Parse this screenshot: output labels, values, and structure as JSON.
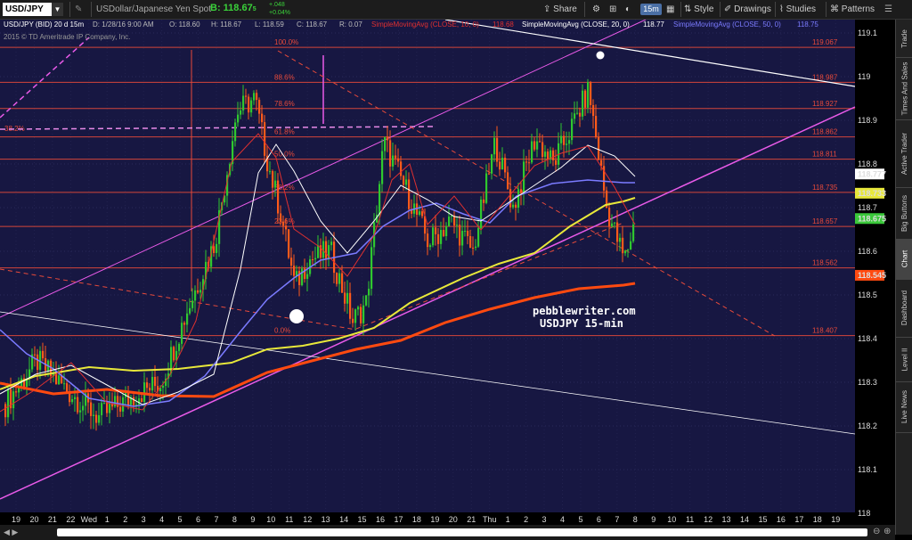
{
  "toolbar": {
    "symbol": "USD/JPY",
    "description": "USDollar/Japanese Yen Spot",
    "bid_label": "B:",
    "bid_value": "118.67",
    "bid_sub": "5",
    "change_top": "+.048",
    "change_bottom": "+0.04%",
    "share": "Share",
    "interval": "15m",
    "style": "Style",
    "drawings": "Drawings",
    "studies": "Studies",
    "patterns": "Patterns"
  },
  "studybar": {
    "title": "USD/JPY (BID) 20 d 15m",
    "date": "D: 1/28/16 9:00 AM",
    "open": "O: 118.60",
    "high": "H: 118.67",
    "low": "L: 118.59",
    "close": "C: 118.67",
    "range": "R: 0.07",
    "sma10": "SimpleMovingAvg (CLOSE, 10, 0)",
    "sma10_val": "118.68",
    "sma20": "SimpleMovingAvg (CLOSE, 20, 0)",
    "sma20_val": "118.77",
    "sma50": "SimpleMovingAvg (CLOSE, 50, 0)",
    "sma50_val": "118.75"
  },
  "copyright": "2015 © TD Ameritrade IP Company, Inc.",
  "watermark": {
    "line1": "pebblewriter.com",
    "line2": "USDJPY 15-min"
  },
  "right_tabs": [
    "Trade",
    "Times And Sales",
    "Active Trader",
    "Big Buttons",
    "Chart",
    "Dashboard",
    "Level II",
    "Live News"
  ],
  "active_tab": "Chart",
  "colors": {
    "background": "#171742",
    "fib": "#e84a3a",
    "sma10": "#e03030",
    "sma20": "#ffffff",
    "sma50": "#7b7bff",
    "sma100": "#e8e83a",
    "sma200": "#ff4a10",
    "channel": "#e85ae8"
  },
  "chart_data": {
    "type": "candlestick",
    "instrument": "USD/JPY",
    "interval": "15m",
    "y_axis_ticks": [
      "119.1",
      "119",
      "118.9",
      "118.8",
      "118.7",
      "118.6",
      "118.5",
      "118.4",
      "118.3",
      "118.2",
      "118.1",
      "118"
    ],
    "ylim": [
      118.0,
      119.1
    ],
    "x_tick_labels": [
      "19",
      "20",
      "21",
      "22",
      "Wed",
      "1",
      "2",
      "3",
      "4",
      "5",
      "6",
      "7",
      "8",
      "9",
      "10",
      "11",
      "12",
      "13",
      "14",
      "15",
      "16",
      "17",
      "18",
      "19",
      "20",
      "21",
      "Thu",
      "1",
      "2",
      "3",
      "4",
      "5",
      "6",
      "7",
      "8",
      "9",
      "10",
      "11",
      "12",
      "13",
      "14",
      "15",
      "16",
      "17",
      "18",
      "19",
      "20",
      "21"
    ],
    "fib_levels": [
      {
        "pct": "100.0%",
        "price": "119.06",
        "sub": "7",
        "value": 119.067
      },
      {
        "pct": "88.6%",
        "price": "118.98",
        "sub": "7",
        "value": 118.987
      },
      {
        "pct": "78.6%",
        "price": "118.92",
        "sub": "7",
        "value": 118.927
      },
      {
        "pct": "61.8%",
        "price": "118.86",
        "sub": "2",
        "value": 118.862
      },
      {
        "pct": "50.0%",
        "price": "118.81",
        "sub": "1",
        "value": 118.811
      },
      {
        "pct": "38.2%",
        "price": "118.73",
        "sub": "5",
        "value": 118.735
      },
      {
        "pct": "23.6%",
        "price": "118.65",
        "sub": "7",
        "value": 118.657
      },
      {
        "pct": "",
        "price": "118.56",
        "sub": "2",
        "value": 118.562
      },
      {
        "pct": "0.0%",
        "price": "118.40",
        "sub": "7",
        "value": 118.407
      }
    ],
    "left_fib_label": "38.2%",
    "price_tags": [
      {
        "price": "118.77",
        "sub": "7",
        "value": 118.777,
        "bg": "#ffffff",
        "fg": "#000000"
      },
      {
        "price": "118.73",
        "sub": "3",
        "value": 118.733,
        "bg": "#e8e83a",
        "fg": "#000000"
      },
      {
        "price": "118.67",
        "sub": "5",
        "value": 118.675,
        "bg": "#3ac83a",
        "fg": "#ffffff"
      },
      {
        "price": "118.54",
        "sub": "5",
        "value": 118.545,
        "bg": "#ff4a10",
        "fg": "#ffffff"
      }
    ]
  }
}
